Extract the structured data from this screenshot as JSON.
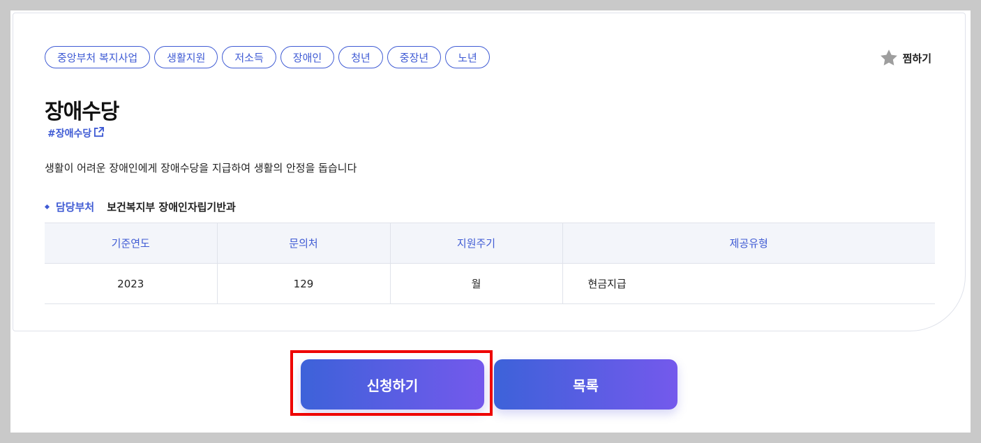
{
  "tags": [
    "중앙부처 복지사업",
    "생활지원",
    "저소득",
    "장애인",
    "청년",
    "중장년",
    "노년"
  ],
  "favorite_label": "찜하기",
  "title": "장애수당",
  "hashtag": "#장애수당",
  "description": "생활이 어려운 장애인에게 장애수당을 지급하여 생활의 안정을 돕습니다",
  "department": {
    "label": "담당부처",
    "value": "보건복지부 장애인자립기반과"
  },
  "table": {
    "headers": [
      "기준연도",
      "문의처",
      "지원주기",
      "제공유형"
    ],
    "row": [
      "2023",
      "129",
      "월",
      "현금지급"
    ]
  },
  "buttons": {
    "apply": "신청하기",
    "list": "목록"
  },
  "colors": {
    "accent": "#3f5bd4",
    "button_gradient_start": "#3d62d9",
    "button_gradient_end": "#7459ec",
    "highlight": "#ee0000"
  }
}
